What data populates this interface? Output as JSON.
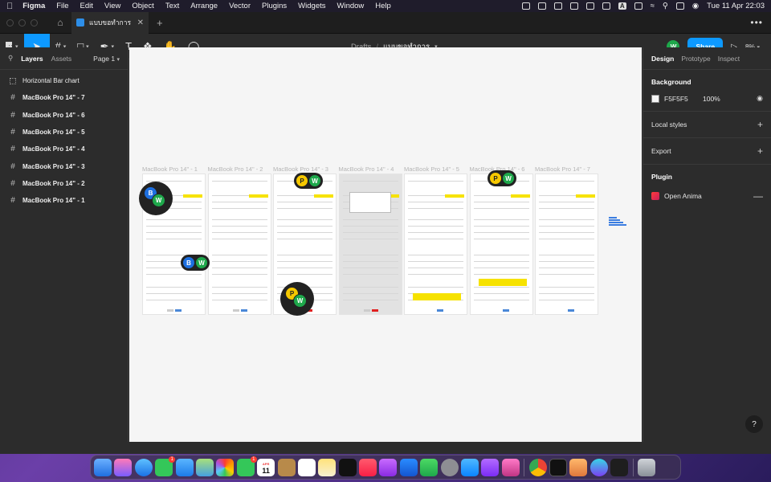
{
  "menubar": {
    "app_name": "Figma",
    "items": [
      "File",
      "Edit",
      "View",
      "Object",
      "Text",
      "Arrange",
      "Vector",
      "Plugins",
      "Widgets",
      "Window",
      "Help"
    ],
    "input_badge": "A",
    "datetime": "Tue 11 Apr  22:03"
  },
  "tabs": {
    "file_tab_label": "แบบขอทำการ",
    "new_tab": "+",
    "more": "•••"
  },
  "toolbar": {
    "breadcrumb_root": "Drafts",
    "breadcrumb_sep": "/",
    "file_name": "แบบขอทำการ",
    "user_initial": "W",
    "share_label": "Share",
    "zoom": "8%"
  },
  "left_panel": {
    "tab_layers": "Layers",
    "tab_assets": "Assets",
    "page": "Page 1",
    "layers": [
      {
        "label": "Horizontal Bar chart",
        "kind": "component"
      },
      {
        "label": "MacBook Pro 14\" - 7",
        "kind": "frame"
      },
      {
        "label": "MacBook Pro 14\" - 6",
        "kind": "frame"
      },
      {
        "label": "MacBook Pro 14\" - 5",
        "kind": "frame"
      },
      {
        "label": "MacBook Pro 14\" - 4",
        "kind": "frame"
      },
      {
        "label": "MacBook Pro 14\" - 3",
        "kind": "frame"
      },
      {
        "label": "MacBook Pro 14\" - 2",
        "kind": "frame"
      },
      {
        "label": "MacBook Pro 14\" - 1",
        "kind": "frame"
      }
    ]
  },
  "canvas": {
    "frames": [
      {
        "title": "MacBook Pro 14\" - 1",
        "dim": false
      },
      {
        "title": "MacBook Pro 14\" - 2",
        "dim": false
      },
      {
        "title": "MacBook Pro 14\" - 3",
        "dim": false
      },
      {
        "title": "MacBook Pro 14\" - 4",
        "dim": true
      },
      {
        "title": "MacBook Pro 14\" - 5",
        "dim": false
      },
      {
        "title": "MacBook Pro 14\" - 6",
        "dim": false
      },
      {
        "title": "MacBook Pro 14\" - 7",
        "dim": false
      }
    ],
    "collaborators": [
      "B",
      "W",
      "P"
    ]
  },
  "right_panel": {
    "tabs": [
      "Design",
      "Prototype",
      "Inspect"
    ],
    "background_title": "Background",
    "background_hex": "F5F5F5",
    "background_opacity": "100%",
    "local_styles": "Local styles",
    "export": "Export",
    "plugin_title": "Plugin",
    "plugin_name": "Open Anima",
    "help": "?"
  },
  "colors": {
    "accent": "#0d99ff",
    "canvas_bg": "#f5f5f5",
    "highlight_yellow": "#f6e200",
    "avatar_w": "#1ea84b",
    "avatar_b": "#1d6fe0",
    "avatar_p": "#f6c800"
  },
  "dock": {
    "calendar_month": "APR",
    "calendar_day": "11",
    "badge_count": "1"
  }
}
